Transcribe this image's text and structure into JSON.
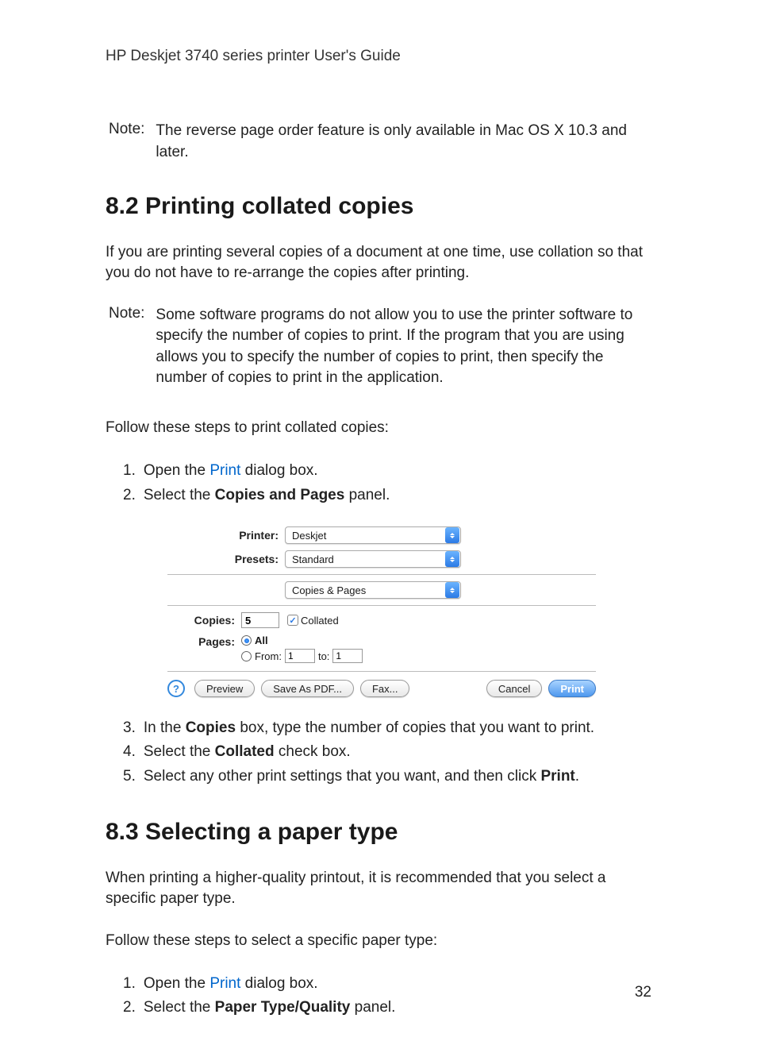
{
  "header": "HP Deskjet 3740 series printer User's Guide",
  "note1": {
    "label": "Note:",
    "text": "The reverse page order feature is only available in Mac OS X 10.3 and later."
  },
  "section82": {
    "heading": "8.2  Printing collated copies",
    "intro": "If you are printing several copies of a document at one time, use collation so that you do not have to re-arrange the copies after printing.",
    "note": {
      "label": "Note:",
      "text": "Some software programs do not allow you to use the printer software to specify the number of copies to print. If the program that you are using allows you to specify the number of copies to print, then specify the number of copies to print in the application."
    },
    "follow": "Follow these steps to print collated copies:",
    "steps": {
      "s1a": "Open the ",
      "s1link": "Print",
      "s1b": " dialog box.",
      "s2a": "Select the ",
      "s2bold": "Copies and Pages",
      "s2b": " panel.",
      "s3a": "In the ",
      "s3bold": "Copies",
      "s3b": " box, type the number of copies that you want to print.",
      "s4a": "Select the ",
      "s4bold": "Collated",
      "s4b": " check box.",
      "s5a": "Select any other print settings that you want, and then click ",
      "s5bold": "Print",
      "s5b": "."
    }
  },
  "dialog": {
    "printer_label": "Printer:",
    "printer_value": "Deskjet",
    "presets_label": "Presets:",
    "presets_value": "Standard",
    "panel_value": "Copies & Pages",
    "copies_label": "Copies:",
    "copies_value": "5",
    "collated_label": "Collated",
    "pages_label": "Pages:",
    "all_label": "All",
    "from_label": "From:",
    "from_value": "1",
    "to_label": "to:",
    "to_value": "1",
    "help": "?",
    "preview": "Preview",
    "savepdf": "Save As PDF...",
    "fax": "Fax...",
    "cancel": "Cancel",
    "print": "Print"
  },
  "section83": {
    "heading": "8.3  Selecting a paper type",
    "intro": "When printing a higher-quality printout, it is recommended that you select a specific paper type.",
    "follow": "Follow these steps to select a specific paper type:",
    "steps": {
      "s1a": "Open the ",
      "s1link": "Print",
      "s1b": " dialog box.",
      "s2a": "Select the ",
      "s2bold": "Paper Type/Quality",
      "s2b": " panel."
    }
  },
  "page_number": "32"
}
